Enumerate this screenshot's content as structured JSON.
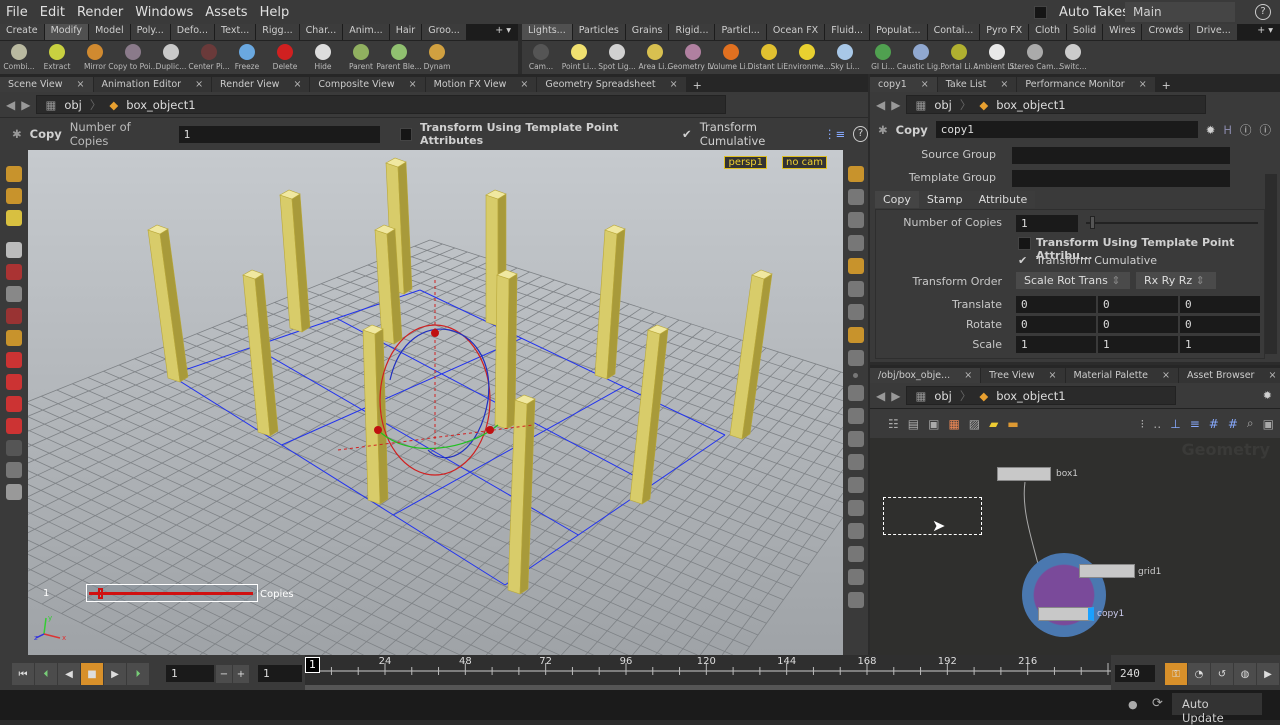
{
  "menu": [
    "File",
    "Edit",
    "Render",
    "Windows",
    "Assets",
    "Help"
  ],
  "auto_takes": "Auto Takes",
  "take": "Main",
  "help": "?",
  "shelf_left": {
    "tabs": [
      "Create",
      "Modify",
      "Model",
      "Poly...",
      "Defo...",
      "Text...",
      "Rigg...",
      "Char...",
      "Anim...",
      "Hair",
      "Groo..."
    ],
    "active": 1,
    "tools": [
      {
        "label": "Combi...",
        "color": "#b9b9a0"
      },
      {
        "label": "Extract",
        "color": "#c8d040"
      },
      {
        "label": "Mirror",
        "color": "#d08a30"
      },
      {
        "label": "Copy to Poi...",
        "color": "#8a7a8a"
      },
      {
        "label": "Duplic...",
        "color": "#c8c8c8"
      },
      {
        "label": "Center Pi...",
        "color": "#6a3a3a"
      },
      {
        "label": "Freeze",
        "color": "#6aa8e0"
      },
      {
        "label": "Delete",
        "color": "#d02020"
      },
      {
        "label": "Hide",
        "color": "#dcdcdc"
      },
      {
        "label": "Parent",
        "color": "#90b060"
      },
      {
        "label": "Parent Ble...",
        "color": "#90c070"
      },
      {
        "label": "Dynam",
        "color": "#d0a040"
      }
    ]
  },
  "shelf_right": {
    "tabs": [
      "Lights...",
      "Particles",
      "Grains",
      "Rigid...",
      "Particl...",
      "Ocean FX",
      "Fluid...",
      "Populat...",
      "Contai...",
      "Pyro FX",
      "Cloth",
      "Solid",
      "Wires",
      "Crowds",
      "Drive..."
    ],
    "active": 0,
    "tools": [
      {
        "label": "Cam...",
        "color": "#555"
      },
      {
        "label": "Point Li...",
        "color": "#f0e070"
      },
      {
        "label": "Spot Lig...",
        "color": "#d0d0d0"
      },
      {
        "label": "Area Li...",
        "color": "#d8c050"
      },
      {
        "label": "Geometry L...",
        "color": "#b080a0"
      },
      {
        "label": "Volume Li...",
        "color": "#e07020"
      },
      {
        "label": "Distant Li...",
        "color": "#e0c030"
      },
      {
        "label": "Environme...",
        "color": "#e8d030"
      },
      {
        "label": "Sky Li...",
        "color": "#a8c8e8"
      },
      {
        "label": "GI Li...",
        "color": "#50a050"
      },
      {
        "label": "Caustic Lig...",
        "color": "#90a8d0"
      },
      {
        "label": "Portal Li...",
        "color": "#b0b030"
      },
      {
        "label": "Ambient Li...",
        "color": "#e8e8e8"
      },
      {
        "label": "Stereo Cam...",
        "color": "#aaa"
      },
      {
        "label": "Switc...",
        "color": "#ccc"
      }
    ]
  },
  "left_pane": {
    "tabs": [
      "Scene View",
      "Animation Editor",
      "Render View",
      "Composite View",
      "Motion FX View",
      "Geometry Spreadsheet"
    ],
    "path": [
      "obj",
      "box_object1"
    ],
    "op": {
      "type": "Copy",
      "copies_label": "Number of Copies",
      "copies": "1",
      "template_label": "Transform Using Template Point Attributes",
      "cumulative_label": "Transform Cumulative",
      "cumulative": true,
      "template": false
    },
    "viewport": {
      "camera": "persp1",
      "cam": "no cam",
      "handle_value": "1",
      "handle_label": "Copies",
      "axis": [
        "x",
        "y",
        "z"
      ]
    }
  },
  "param_pane": {
    "tabs": [
      "copy1",
      "Take List",
      "Performance Monitor"
    ],
    "path": [
      "obj",
      "box_object1"
    ],
    "op_type": "Copy",
    "node_name": "copy1",
    "source_group": "Source Group",
    "template_group": "Template Group",
    "subtabs": [
      "Copy",
      "Stamp",
      "Attribute"
    ],
    "num_copies_label": "Number of Copies",
    "num_copies": "1",
    "num_copies_slider": 0.0,
    "template_label": "Transform Using Template Point Attribu...",
    "cumulative_label": "Transform Cumulative",
    "order_label": "Transform Order",
    "order": "Scale Rot Trans",
    "rot_order": "Rx Ry Rz",
    "rows": [
      {
        "label": "Translate",
        "v": [
          "0",
          "0",
          "0"
        ]
      },
      {
        "label": "Rotate",
        "v": [
          "0",
          "0",
          "0"
        ]
      },
      {
        "label": "Scale",
        "v": [
          "1",
          "1",
          "1"
        ]
      }
    ]
  },
  "network_pane": {
    "tabs": [
      "/obj/box_obje...",
      "Tree View",
      "Material Palette",
      "Asset Browser"
    ],
    "path": [
      "obj",
      "box_object1"
    ],
    "watermark": "Geometry",
    "nodes": {
      "box": "box1",
      "grid": "grid1",
      "copy": "copy1"
    }
  },
  "timeline": {
    "start": "1",
    "step": "1",
    "current": "1",
    "end": "240",
    "ticks": [
      "24",
      "48",
      "72",
      "96",
      "120",
      "144",
      "168",
      "192",
      "216"
    ],
    "range": [
      1,
      240
    ]
  },
  "status": {
    "update": "Auto Update"
  }
}
